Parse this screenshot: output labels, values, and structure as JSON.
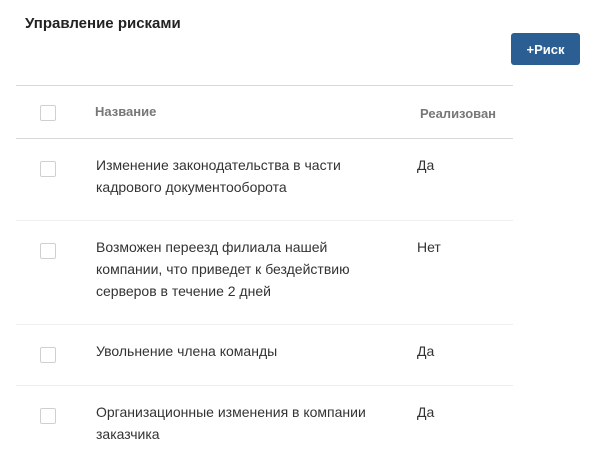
{
  "page": {
    "title": "Управление рисками",
    "add_button_label": "+Риск"
  },
  "table": {
    "columns": {
      "name": "Название",
      "implemented": "Реализован"
    },
    "rows": [
      {
        "name": "Изменение законодательства в части кадрового документооборота",
        "implemented": "Да"
      },
      {
        "name": "Возможен переезд филиала нашей компании, что приведет к бездействию серверов в течение 2 дней",
        "implemented": "Нет"
      },
      {
        "name": "Увольнение члена команды",
        "implemented": "Да"
      },
      {
        "name": "Организационные изменения в компании заказчика",
        "implemented": "Да"
      }
    ]
  },
  "colors": {
    "accent": "#2b5f94"
  }
}
